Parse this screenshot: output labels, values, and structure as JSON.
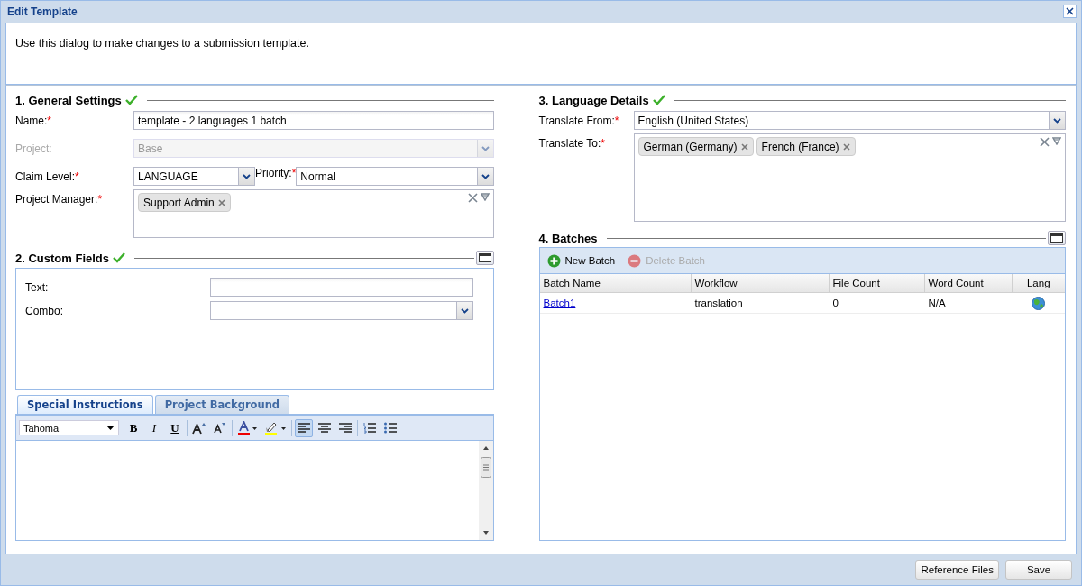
{
  "window": {
    "title": "Edit Template"
  },
  "intro": "Use this dialog to make changes to a submission template.",
  "general_settings": {
    "title": "1. General Settings",
    "valid": true,
    "fields": [
      {
        "kind": "text",
        "label": "Name:",
        "required_mark": "*",
        "value": "template - 2 languages 1 batch"
      },
      {
        "kind": "combo",
        "label": "Project:",
        "disabled": true,
        "value": "Base"
      },
      {
        "kind": "pair",
        "items": [
          {
            "kind": "combo",
            "label": "Claim Level:",
            "required_mark": "*",
            "value": "LANGUAGE"
          },
          {
            "kind": "combo",
            "label": "Priority:",
            "required_mark": "*",
            "value": "Normal"
          }
        ]
      },
      {
        "kind": "tags",
        "label": "Project Manager:",
        "required_mark": "*",
        "tags": [
          "Support Admin"
        ]
      }
    ]
  },
  "custom_fields": {
    "title": "2. Custom Fields",
    "valid": true,
    "fields": [
      {
        "kind": "text",
        "label": "Text:"
      },
      {
        "kind": "combo",
        "label": "Combo:"
      }
    ]
  },
  "editor": {
    "tabs": [
      {
        "label": "Special Instructions",
        "selected": true
      },
      {
        "label": "Project Background",
        "selected": false
      }
    ],
    "font": "Tahoma",
    "toolbar": [
      {
        "kind": "bold",
        "label": "B",
        "selected": false
      },
      {
        "kind": "italic",
        "label": "I",
        "selected": false
      },
      {
        "kind": "underline",
        "label": "U",
        "selected": false
      },
      {
        "kind": "sep"
      },
      {
        "kind": "grow",
        "selected": false
      },
      {
        "kind": "shrink",
        "selected": false
      },
      {
        "kind": "sep"
      },
      {
        "kind": "font-color",
        "selected": false
      },
      {
        "kind": "highlight",
        "selected": false
      },
      {
        "kind": "sep"
      },
      {
        "kind": "align-left",
        "selected": true
      },
      {
        "kind": "align-center",
        "selected": false
      },
      {
        "kind": "align-right",
        "selected": false
      },
      {
        "kind": "sep"
      },
      {
        "kind": "ordered-list",
        "selected": false
      },
      {
        "kind": "bullet-list",
        "selected": false
      }
    ]
  },
  "language_details": {
    "title": "3. Language Details",
    "valid": true,
    "fields": [
      {
        "kind": "combo",
        "label": "Translate From:",
        "required_mark": "*",
        "value": "English (United States)"
      },
      {
        "kind": "tags",
        "label": "Translate To:",
        "required_mark": "*",
        "tags": [
          "German (Germany)",
          "French (France)"
        ]
      }
    ]
  },
  "batches": {
    "title": "4. Batches",
    "toolbar": [
      {
        "kind": "add",
        "label": "New Batch",
        "disabled": false
      },
      {
        "kind": "delete",
        "label": "Delete Batch",
        "disabled": true
      }
    ],
    "columns": [
      "Batch Name",
      "Workflow",
      "File Count",
      "Word Count",
      "Lang"
    ],
    "rows": [
      {
        "batch_name": "Batch1",
        "workflow": "translation",
        "file_count": "0",
        "word_count": "N/A"
      }
    ]
  },
  "buttons": [
    "Reference Files",
    "Save"
  ]
}
